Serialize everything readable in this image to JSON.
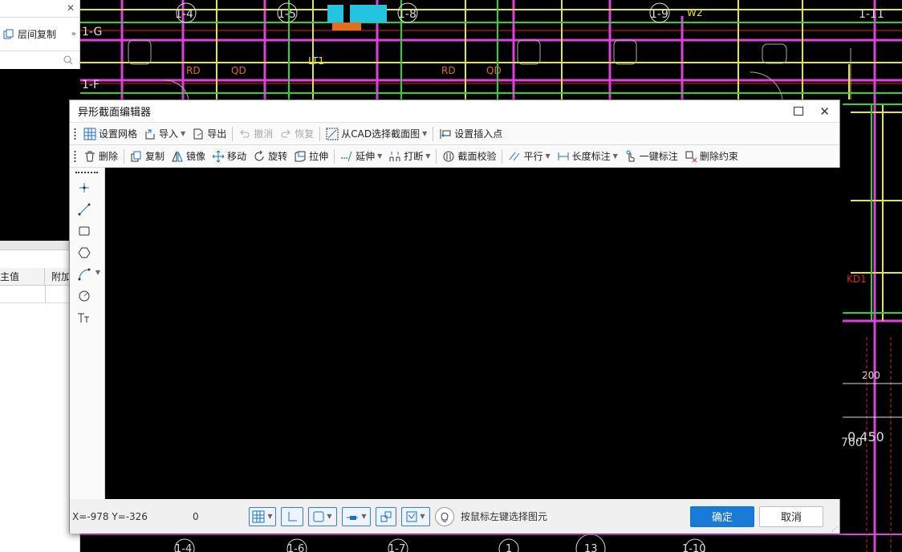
{
  "cad": {
    "axis_labels_top": [
      "1-4",
      "1-5",
      "1-8",
      "1-9",
      "1-11"
    ],
    "axis_labels_left": [
      "1-G",
      "1-F"
    ],
    "axis_labels_bottom": [
      "1-4",
      "1-6",
      "1-7",
      "1",
      "13",
      "1-10"
    ],
    "annotations": [
      "LT1",
      "RD",
      "QD",
      "RD",
      "QD",
      "KD1",
      "200",
      "0.450",
      "700",
      "W2"
    ]
  },
  "left_panel": {
    "copy_label": "层间复制",
    "col_value": "主值",
    "col_extra": "附加"
  },
  "dialog": {
    "title": "异形截面编辑器",
    "toolbar1": {
      "grid": "设置网格",
      "import": "导入",
      "export": "导出",
      "undo": "撤消",
      "redo": "恢复",
      "from_cad": "从CAD选择截面图",
      "insert_point": "设置插入点"
    },
    "toolbar2": {
      "delete": "删除",
      "copy": "复制",
      "mirror": "镜像",
      "move": "移动",
      "rotate": "旋转",
      "stretch": "拉伸",
      "extend": "延伸",
      "break": "打断",
      "check": "截面校验",
      "parallel": "平行",
      "dimension": "长度标注",
      "auto_dim": "一键标注",
      "del_constraint": "删除约束"
    },
    "status": {
      "coords": "X=-978 Y=-326",
      "value": "0",
      "hint": "按鼠标左键选择图元",
      "ok": "确定",
      "cancel": "取消"
    }
  }
}
